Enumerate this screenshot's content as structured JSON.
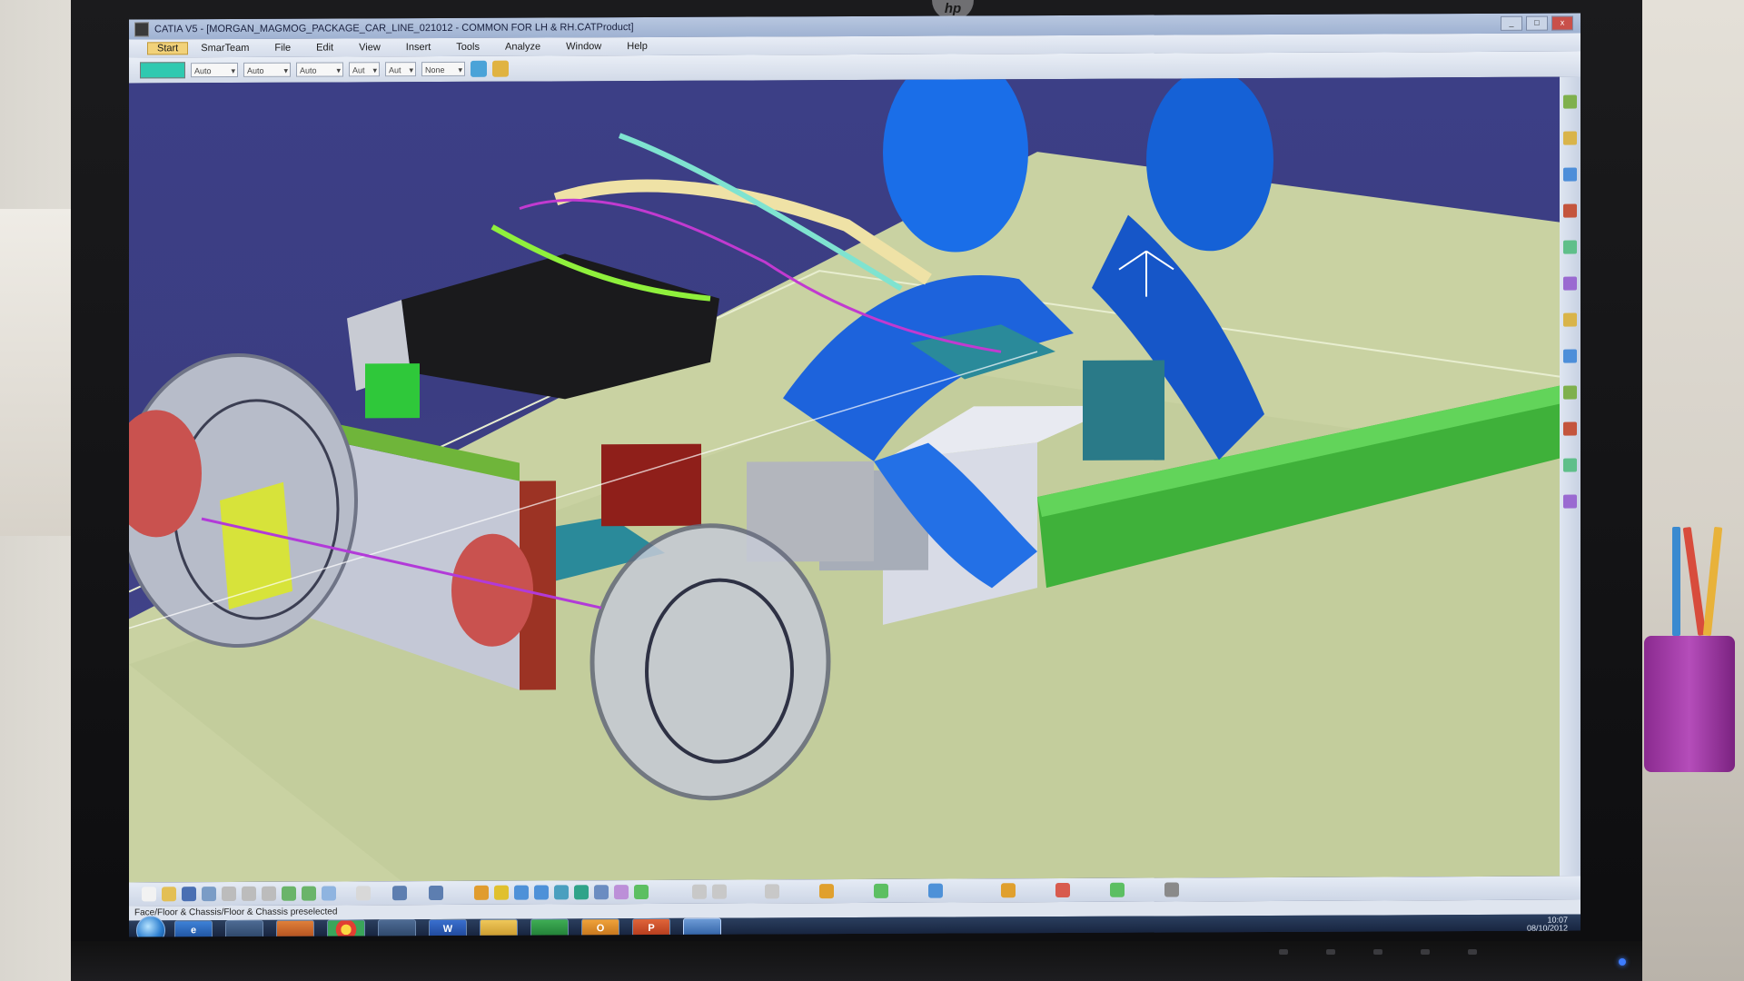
{
  "monitor": {
    "brand": "hp"
  },
  "window": {
    "title": "CATIA V5 - [MORGAN_MAGMOG_PACKAGE_CAR_LINE_021012 - COMMON FOR LH & RH.CATProduct]",
    "controls": [
      "_",
      "□",
      "x"
    ]
  },
  "menubar": {
    "items": [
      "Start",
      "SmarTeam",
      "File",
      "Edit",
      "View",
      "Insert",
      "Tools",
      "Analyze",
      "Window",
      "Help"
    ]
  },
  "properties_toolbar": {
    "fill_color": "#2fc9b0",
    "dropdowns": [
      "Auto",
      "Auto",
      "Auto",
      "Aut",
      "Aut",
      "None"
    ]
  },
  "status_bar": {
    "text": "Face/Floor & Chassis/Floor & Chassis  preselected"
  },
  "taskbar": {
    "apps": [
      "start-orb",
      "internet-explorer",
      "catia",
      "media-player",
      "chrome",
      "calculator",
      "W",
      "explorer",
      "excel",
      "outlook",
      "powerpoint",
      "catia-active"
    ],
    "labels": {
      "word": "W",
      "outlook": "O",
      "powerpoint": "P"
    },
    "clock_time": "10:07",
    "clock_date": "08/10/2012"
  },
  "colors": {
    "viewport_bg": "#3c3f86",
    "floor": "#c9d2a2",
    "manikin": "#1a6ee8",
    "teal_parts": "#2a8a9a",
    "green_chassis": "#3fb13a"
  }
}
